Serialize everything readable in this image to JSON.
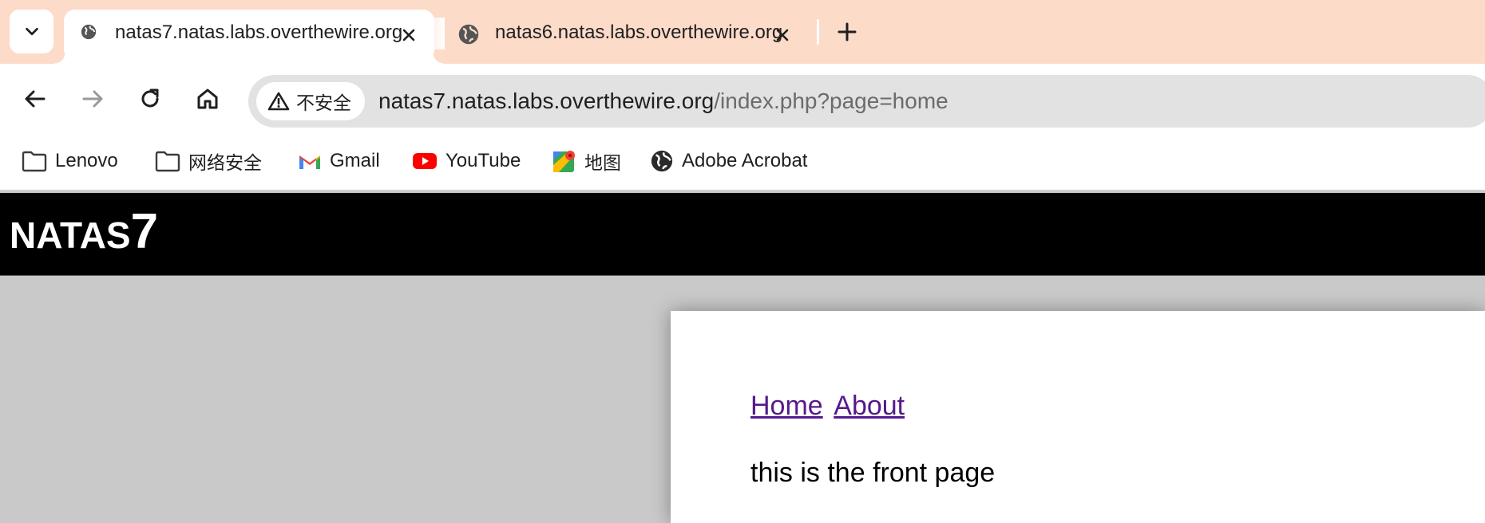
{
  "tabs": [
    {
      "title": "natas7.natas.labs.overthewire.org",
      "active": true,
      "favicon": "globe-icon"
    },
    {
      "title": "natas6.natas.labs.overthewire.org",
      "active": false,
      "favicon": "globe-icon"
    }
  ],
  "toolbar": {
    "security_label": "不安全",
    "url_host": "natas7.natas.labs.overthewire.org",
    "url_path": "/index.php?page=home"
  },
  "bookmarks": [
    {
      "label": "Lenovo",
      "icon": "folder-icon"
    },
    {
      "label": "网络安全",
      "icon": "folder-icon"
    },
    {
      "label": "Gmail",
      "icon": "gmail-icon"
    },
    {
      "label": "YouTube",
      "icon": "youtube-icon"
    },
    {
      "label": "地图",
      "icon": "maps-icon"
    },
    {
      "label": "Adobe Acrobat",
      "icon": "globe-icon"
    }
  ],
  "page": {
    "title_word": "NATAS",
    "title_num": "7",
    "links": [
      "Home",
      "About"
    ],
    "text": "this is the front page"
  },
  "colors": {
    "tabstrip_bg": "#fddbc9",
    "link_visited": "#551a8b",
    "header_bg": "#000000",
    "page_bg": "#c9c9c9"
  }
}
